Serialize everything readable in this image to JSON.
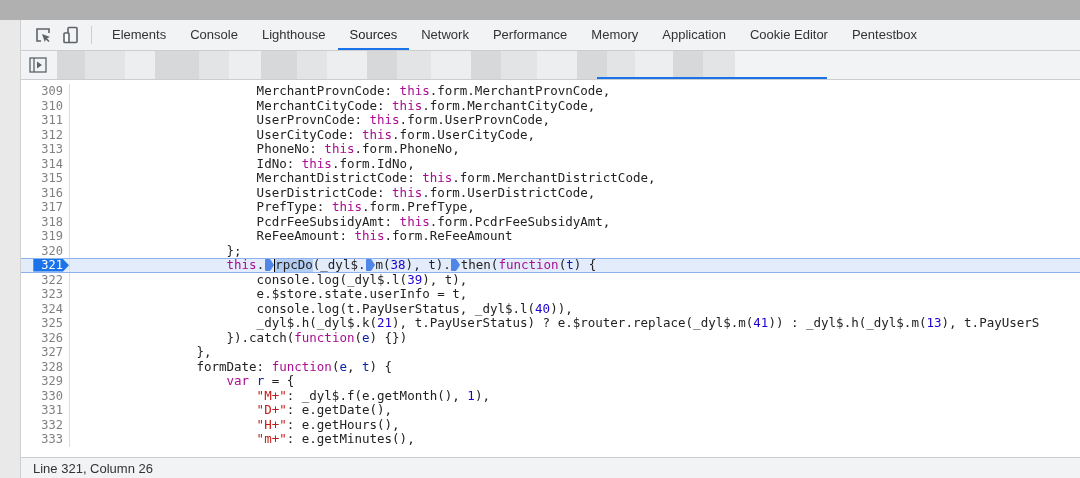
{
  "tabs": [
    {
      "label": "Elements",
      "selected": false
    },
    {
      "label": "Console",
      "selected": false
    },
    {
      "label": "Lighthouse",
      "selected": false
    },
    {
      "label": "Sources",
      "selected": true
    },
    {
      "label": "Network",
      "selected": false
    },
    {
      "label": "Performance",
      "selected": false
    },
    {
      "label": "Memory",
      "selected": false
    },
    {
      "label": "Application",
      "selected": false
    },
    {
      "label": "Cookie Editor",
      "selected": false
    },
    {
      "label": "Pentestbox",
      "selected": false
    }
  ],
  "lines": [
    {
      "number": "309",
      "breakpoint": false,
      "current": false,
      "tokens": [
        {
          "kind": "plain",
          "text": "                        MerchantProvnCode: "
        },
        {
          "kind": "keyword",
          "text": "this"
        },
        {
          "kind": "plain",
          "text": ".form.MerchantProvnCode,"
        }
      ]
    },
    {
      "number": "310",
      "breakpoint": false,
      "current": false,
      "tokens": [
        {
          "kind": "plain",
          "text": "                        MerchantCityCode: "
        },
        {
          "kind": "keyword",
          "text": "this"
        },
        {
          "kind": "plain",
          "text": ".form.MerchantCityCode,"
        }
      ]
    },
    {
      "number": "311",
      "breakpoint": false,
      "current": false,
      "tokens": [
        {
          "kind": "plain",
          "text": "                        UserProvnCode: "
        },
        {
          "kind": "keyword",
          "text": "this"
        },
        {
          "kind": "plain",
          "text": ".form.UserProvnCode,"
        }
      ]
    },
    {
      "number": "312",
      "breakpoint": false,
      "current": false,
      "tokens": [
        {
          "kind": "plain",
          "text": "                        UserCityCode: "
        },
        {
          "kind": "keyword",
          "text": "this"
        },
        {
          "kind": "plain",
          "text": ".form.UserCityCode,"
        }
      ]
    },
    {
      "number": "313",
      "breakpoint": false,
      "current": false,
      "tokens": [
        {
          "kind": "plain",
          "text": "                        PhoneNo: "
        },
        {
          "kind": "keyword",
          "text": "this"
        },
        {
          "kind": "plain",
          "text": ".form.PhoneNo,"
        }
      ]
    },
    {
      "number": "314",
      "breakpoint": false,
      "current": false,
      "tokens": [
        {
          "kind": "plain",
          "text": "                        IdNo: "
        },
        {
          "kind": "keyword",
          "text": "this"
        },
        {
          "kind": "plain",
          "text": ".form.IdNo,"
        }
      ]
    },
    {
      "number": "315",
      "breakpoint": false,
      "current": false,
      "tokens": [
        {
          "kind": "plain",
          "text": "                        MerchantDistrictCode: "
        },
        {
          "kind": "keyword",
          "text": "this"
        },
        {
          "kind": "plain",
          "text": ".form.MerchantDistrictCode,"
        }
      ]
    },
    {
      "number": "316",
      "breakpoint": false,
      "current": false,
      "tokens": [
        {
          "kind": "plain",
          "text": "                        UserDistrictCode: "
        },
        {
          "kind": "keyword",
          "text": "this"
        },
        {
          "kind": "plain",
          "text": ".form.UserDistrictCode,"
        }
      ]
    },
    {
      "number": "317",
      "breakpoint": false,
      "current": false,
      "tokens": [
        {
          "kind": "plain",
          "text": "                        PrefType: "
        },
        {
          "kind": "keyword",
          "text": "this"
        },
        {
          "kind": "plain",
          "text": ".form.PrefType,"
        }
      ]
    },
    {
      "number": "318",
      "breakpoint": false,
      "current": false,
      "tokens": [
        {
          "kind": "plain",
          "text": "                        PcdrFeeSubsidyAmt: "
        },
        {
          "kind": "keyword",
          "text": "this"
        },
        {
          "kind": "plain",
          "text": ".form.PcdrFeeSubsidyAmt,"
        }
      ]
    },
    {
      "number": "319",
      "breakpoint": false,
      "current": false,
      "tokens": [
        {
          "kind": "plain",
          "text": "                        ReFeeAmount: "
        },
        {
          "kind": "keyword",
          "text": "this"
        },
        {
          "kind": "plain",
          "text": ".form.ReFeeAmount"
        }
      ]
    },
    {
      "number": "320",
      "breakpoint": false,
      "current": false,
      "tokens": [
        {
          "kind": "plain",
          "text": "                    };"
        }
      ]
    },
    {
      "number": "321",
      "breakpoint": true,
      "current": true,
      "tokens": [
        {
          "kind": "keyword",
          "text": "                    this"
        },
        {
          "kind": "plain",
          "text": "."
        },
        {
          "kind": "marker"
        },
        {
          "kind": "selected",
          "text": "rpcDo"
        },
        {
          "kind": "plain",
          "text": "(_dyl$."
        },
        {
          "kind": "marker"
        },
        {
          "kind": "plain",
          "text": "m("
        },
        {
          "kind": "number",
          "text": "38"
        },
        {
          "kind": "plain",
          "text": "), t)."
        },
        {
          "kind": "marker"
        },
        {
          "kind": "plain",
          "text": "then("
        },
        {
          "kind": "keyword",
          "text": "function"
        },
        {
          "kind": "plain",
          "text": "("
        },
        {
          "kind": "def",
          "text": "t"
        },
        {
          "kind": "plain",
          "text": ") {"
        }
      ]
    },
    {
      "number": "322",
      "breakpoint": false,
      "current": false,
      "tokens": [
        {
          "kind": "plain",
          "text": "                        console.log(_dyl$.l("
        },
        {
          "kind": "number",
          "text": "39"
        },
        {
          "kind": "plain",
          "text": "), t),"
        }
      ]
    },
    {
      "number": "323",
      "breakpoint": false,
      "current": false,
      "tokens": [
        {
          "kind": "plain",
          "text": "                        e.$store.state.userInfo = t,"
        }
      ]
    },
    {
      "number": "324",
      "breakpoint": false,
      "current": false,
      "tokens": [
        {
          "kind": "plain",
          "text": "                        console.log(t.PayUserStatus, _dyl$.l("
        },
        {
          "kind": "number",
          "text": "40"
        },
        {
          "kind": "plain",
          "text": ")),"
        }
      ]
    },
    {
      "number": "325",
      "breakpoint": false,
      "current": false,
      "tokens": [
        {
          "kind": "plain",
          "text": "                        _dyl$.h(_dyl$.k("
        },
        {
          "kind": "number",
          "text": "21"
        },
        {
          "kind": "plain",
          "text": "), t.PayUserStatus) ? e.$router.replace(_dyl$.m("
        },
        {
          "kind": "number",
          "text": "41"
        },
        {
          "kind": "plain",
          "text": ")) : _dyl$.h(_dyl$.m("
        },
        {
          "kind": "number",
          "text": "13"
        },
        {
          "kind": "plain",
          "text": "), t.PayUserS"
        }
      ]
    },
    {
      "number": "326",
      "breakpoint": false,
      "current": false,
      "tokens": [
        {
          "kind": "plain",
          "text": "                    }).catch("
        },
        {
          "kind": "keyword",
          "text": "function"
        },
        {
          "kind": "plain",
          "text": "("
        },
        {
          "kind": "def",
          "text": "e"
        },
        {
          "kind": "plain",
          "text": ") {})"
        }
      ]
    },
    {
      "number": "327",
      "breakpoint": false,
      "current": false,
      "tokens": [
        {
          "kind": "plain",
          "text": "                },"
        }
      ]
    },
    {
      "number": "328",
      "breakpoint": false,
      "current": false,
      "tokens": [
        {
          "kind": "plain",
          "text": "                formDate: "
        },
        {
          "kind": "keyword",
          "text": "function"
        },
        {
          "kind": "plain",
          "text": "("
        },
        {
          "kind": "def",
          "text": "e"
        },
        {
          "kind": "plain",
          "text": ", "
        },
        {
          "kind": "def",
          "text": "t"
        },
        {
          "kind": "plain",
          "text": ") {"
        }
      ]
    },
    {
      "number": "329",
      "breakpoint": false,
      "current": false,
      "tokens": [
        {
          "kind": "keyword",
          "text": "                    var "
        },
        {
          "kind": "def",
          "text": "r"
        },
        {
          "kind": "plain",
          "text": " = {"
        }
      ]
    },
    {
      "number": "330",
      "breakpoint": false,
      "current": false,
      "tokens": [
        {
          "kind": "string",
          "text": "                        \"M+\""
        },
        {
          "kind": "plain",
          "text": ": _dyl$.f(e.getMonth(), "
        },
        {
          "kind": "number",
          "text": "1"
        },
        {
          "kind": "plain",
          "text": "),"
        }
      ]
    },
    {
      "number": "331",
      "breakpoint": false,
      "current": false,
      "tokens": [
        {
          "kind": "string",
          "text": "                        \"D+\""
        },
        {
          "kind": "plain",
          "text": ": e.getDate(),"
        }
      ]
    },
    {
      "number": "332",
      "breakpoint": false,
      "current": false,
      "tokens": [
        {
          "kind": "string",
          "text": "                        \"H+\""
        },
        {
          "kind": "plain",
          "text": ": e.getHours(),"
        }
      ]
    },
    {
      "number": "333",
      "breakpoint": false,
      "current": false,
      "tokens": [
        {
          "kind": "string",
          "text": "                        \"m+\""
        },
        {
          "kind": "plain",
          "text": ": e.getMinutes(),"
        }
      ]
    }
  ],
  "status_bar": "Line 321, Column 26"
}
